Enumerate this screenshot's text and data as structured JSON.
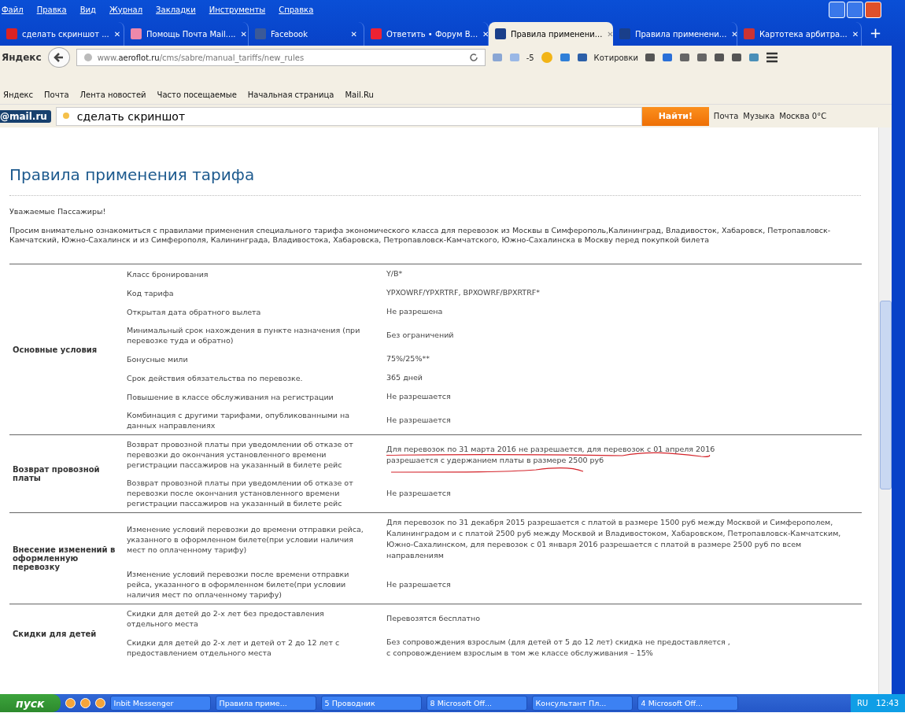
{
  "menu": [
    "Файл",
    "Правка",
    "Вид",
    "Журнал",
    "Закладки",
    "Инструменты",
    "Справка"
  ],
  "tabs": [
    {
      "label": "сделать скриншот ...",
      "selected": false
    },
    {
      "label": "Помощь Почта Mail....",
      "selected": false
    },
    {
      "label": "Facebook",
      "selected": false
    },
    {
      "label": "Ответить • Форум В...",
      "selected": false
    },
    {
      "label": "Правила применени...",
      "selected": true
    },
    {
      "label": "Правила применени...",
      "selected": false
    },
    {
      "label": "Картотека арбитра...",
      "selected": false
    }
  ],
  "new_tab": "+",
  "close_mark": "✕",
  "brand": "Яндекс",
  "url": {
    "host_prefix": "www.",
    "host": "aeroflot.ru",
    "path": "/cms/sabre/manual_tariffs/new_rules"
  },
  "toolbar": {
    "weather": "-5",
    "quotes": "Котировки"
  },
  "bookmarks": [
    "Яндекс",
    "Почта",
    "Лента новостей",
    "Часто посещаемые",
    "Начальная страница",
    "Mail.Ru"
  ],
  "mailbar": {
    "logo": "@mail.ru",
    "query": "сделать скриншот",
    "button": "Найти!",
    "links": [
      "Почта",
      "Музыка",
      "Москва 0°C"
    ]
  },
  "page": {
    "title": "Правила применения тарифа",
    "greeting": "Уважаемые Пассажиры!",
    "intro": "Просим внимательно ознакомиться с правилами применения специального тарифа экономического класса для перевозок из Москвы в Симферополь,Калининград,  Владивосток, Хабаровск, Петропавловск-Камчатский, Южно-Сахалинск    и из Симферополя, Калининграда, Владивостока, Хабаровска, Петропавловск-Камчатского, Южно-Сахалинска   в Москву   перед покупкой билета",
    "sections": [
      {
        "label": "Основные условия",
        "rows": [
          {
            "condition": "Класс бронирования",
            "value": "Y/B*"
          },
          {
            "condition": "Код тарифа",
            "value": "YPXOWRF/YPXRTRF, BPXOWRF/BPXRTRF*"
          },
          {
            "condition": "Открытая дата обратного вылета",
            "value": "Не разрешена"
          },
          {
            "condition": "Минимальный срок нахождения в пункте назначения (при перевозке туда и обратно)",
            "value": " Без ограничений"
          },
          {
            "condition": "Бонусные мили",
            "value": "75%/25%**"
          },
          {
            "condition": "Срок действия  обязательства по перевозке.",
            "value": "365 дней"
          },
          {
            "condition": "Повышение в классе обслуживания на регистрации",
            "value": "Не разрешается"
          },
          {
            "condition": "Комбинация с другими тарифами, опубликованными на данных направлениях",
            "value": "Не разрешается"
          }
        ]
      },
      {
        "label": "Возврат провозной платы",
        "rows": [
          {
            "condition": "Возврат провозной платы при уведомлении об отказе от перевозки  до окончания установленного времени регистрации пассажиров на указанный в билете рейс",
            "value": "Для перевозок по 31 марта 2016 не разрешается, для перевозок с 01 апреля 2016\nразрешается с удержанием  платы в размере 2500 руб",
            "underlined": true
          },
          {
            "condition": "Возврат провозной платы при уведомлении об отказе от перевозки  после окончания установленного времени регистрации пассажиров на указанный в билете рейс",
            "value": "Не разрешается"
          }
        ]
      },
      {
        "label": "Внесение изменений в оформленную перевозку",
        "rows": [
          {
            "condition": "Изменение условий перевозки  до времени отправки рейса, указанного в оформленном билете(при условии наличия мест по оплаченному тарифу)",
            "value": "Для перевозок по 31 декабря 2015 разрешается с платой в размере 1500 руб между Москвой и Симферополем, Калининградом  и с платой  2500 руб между Москвой и  Владивостоком, Хабаровском, Петропавловск-Камчатским, Южно-Сахалинском, для перевозок с 01 января 2016 разрешается с платой в размере 2500 руб по всем направлениям"
          },
          {
            "condition": "Изменение условий перевозки  после  времени отправки рейса, указанного в оформленном билете(при условии наличия мест по оплаченному тарифу)",
            "value": "Не разрешается"
          }
        ]
      },
      {
        "label": "Скидки для детей",
        "rows": [
          {
            "condition": "Скидки для детей до 2-х лет без предоставления отдельного места",
            "value": "Перевозятся  бесплатно"
          },
          {
            "condition": "Скидки для детей до 2-х лет и детей от 2 до 12 лет с предоставлением отдельного места",
            "value": "Без сопровождения взрослым (для детей от 5 до 12 лет) скидка не предоставляется ,\nс сопровождением взрослым  в том же классе обслуживания – 15%"
          }
        ]
      }
    ]
  },
  "taskbar": {
    "start": "пуск",
    "items": [
      "Inbit Messenger",
      "Правила приме...",
      "5 Проводник",
      "8 Microsoft Off...",
      "Консультант Пл...",
      "4 Microsoft Off..."
    ],
    "lang": "RU",
    "clock": "12:43"
  }
}
